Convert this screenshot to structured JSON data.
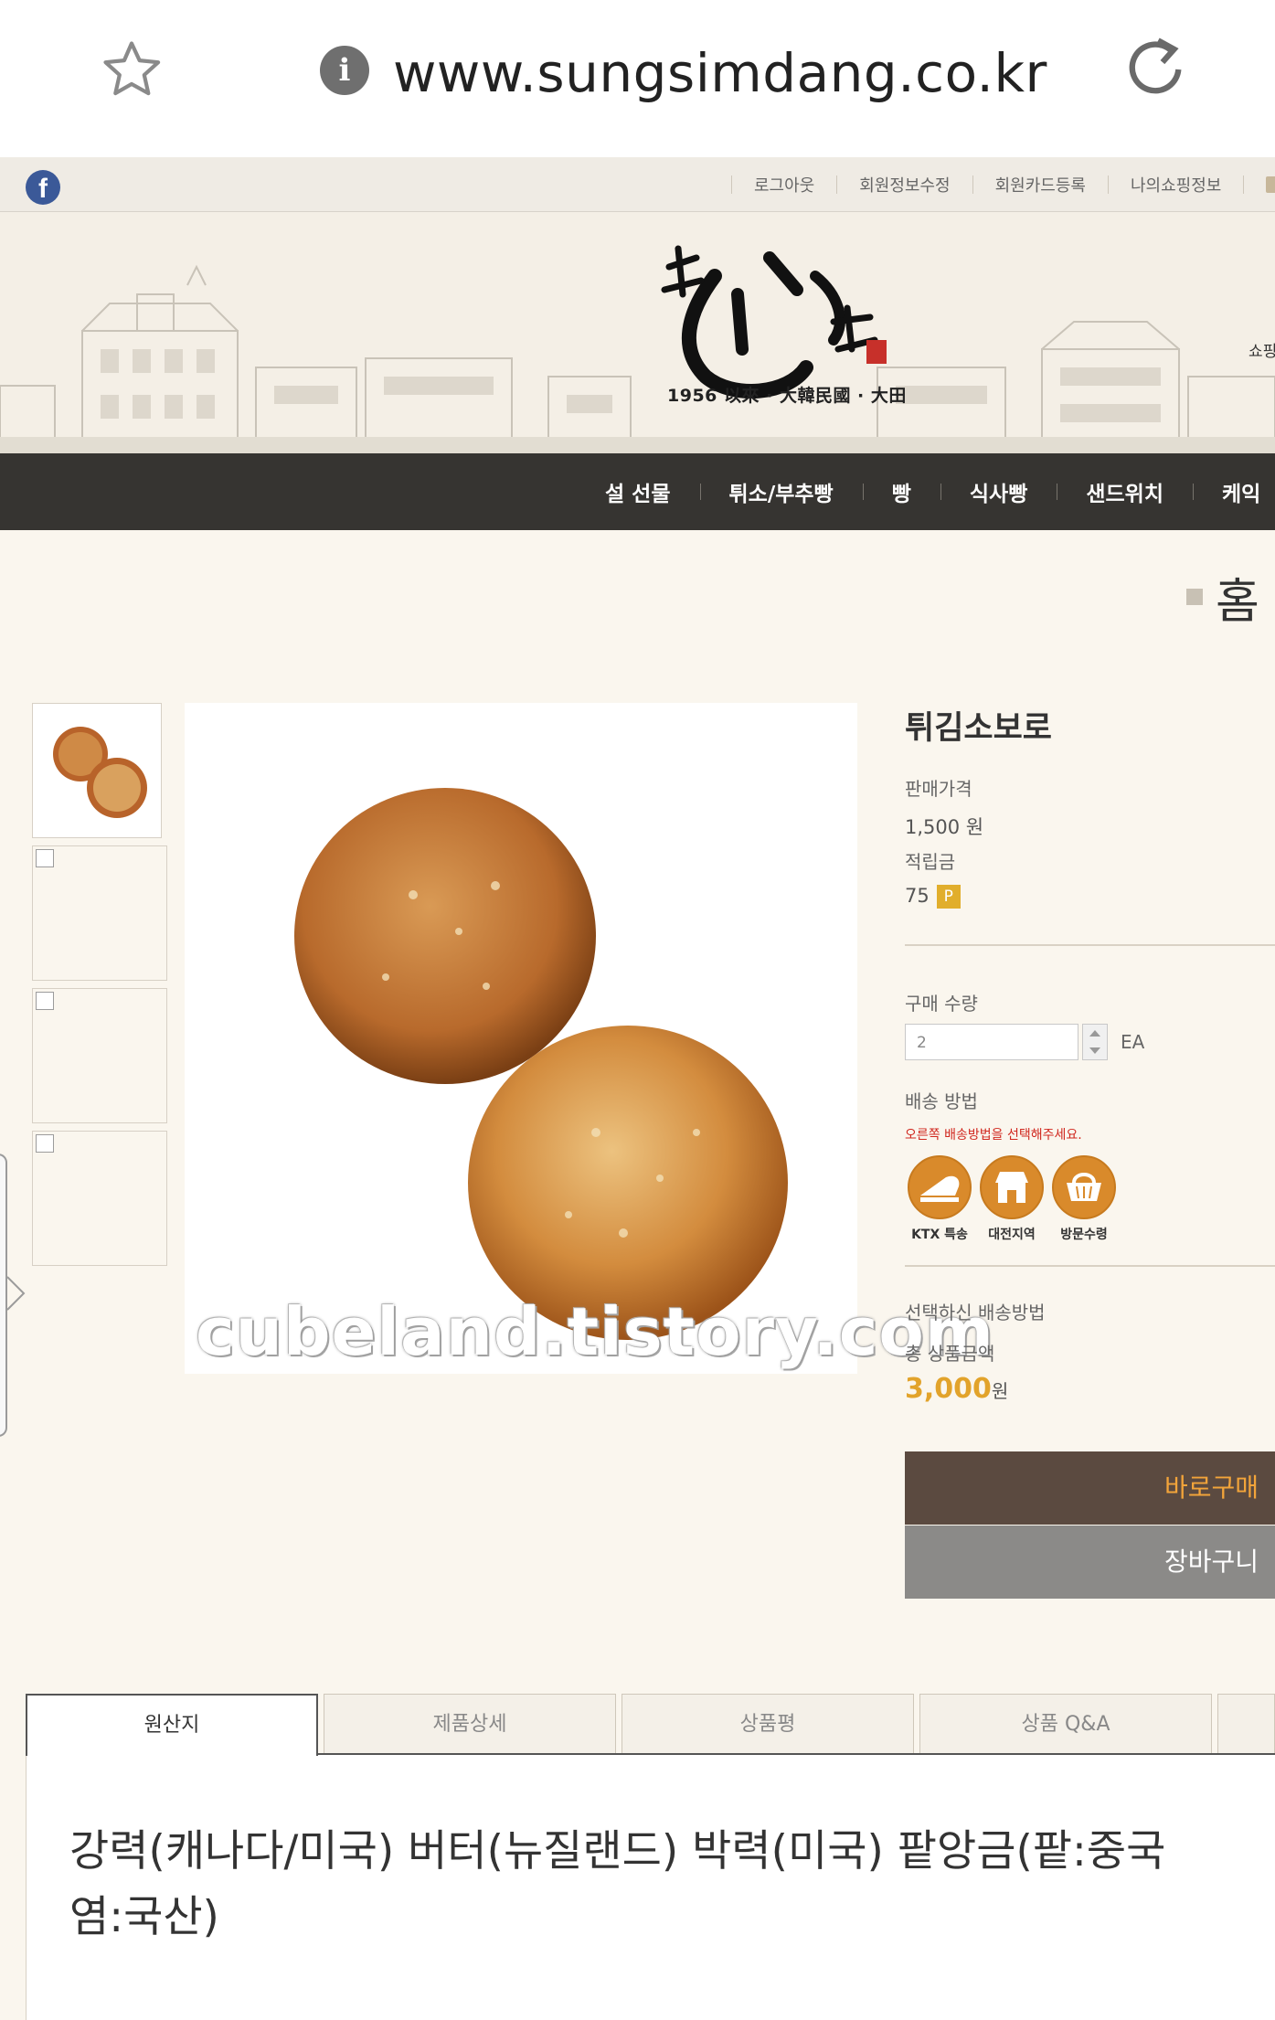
{
  "browser": {
    "url": "www.sungsimdang.co.kr"
  },
  "util_links": [
    "로그아웃",
    "회원정보수정",
    "회원카드등록",
    "나의쇼핑정보"
  ],
  "header": {
    "logo_tagline": "1956 以來 · 大韓民國 · 大田",
    "edge_text": "쇼핑"
  },
  "nav": [
    "설 선물",
    "튀소/부추빵",
    "빵",
    "식사빵",
    "샌드위치",
    "케익"
  ],
  "breadcrumb": {
    "home": "홈"
  },
  "watermark": "cubeland.tistory.com",
  "product": {
    "name": "튀김소보로",
    "price_label": "판매가격",
    "price": "1,500 원",
    "points_label": "적립금",
    "points": "75",
    "points_badge": "P",
    "qty_label": "구매 수량",
    "qty_value": "2",
    "qty_unit": "EA",
    "delivery_label": "배송 방법",
    "delivery_note": "오른쪽 배송방법을 선택해주세요.",
    "delivery_options": [
      "KTX 특송",
      "대전지역",
      "방문수령"
    ],
    "selected_delivery_label": "선택하신 배송방법",
    "total_label": "총 상품금액",
    "total_value": "3,000",
    "total_unit": "원",
    "buy_now": "바로구매",
    "add_to_cart": "장바구니"
  },
  "tabs": [
    "원산지",
    "제품상세",
    "상품평",
    "상품 Q&A"
  ],
  "origin_text": {
    "line1": "강력(캐나다/미국) 버터(뉴질랜드) 박력(미국) 팥앙금(팥:중국",
    "line2": "염:국산)"
  },
  "colors": {
    "nav_bg": "#363431",
    "buy_button": "#5b4a40",
    "buy_text": "#f2a43a",
    "cart_button": "#8b8a88",
    "total_price": "#e2a32b",
    "delivery_note": "#d0271e",
    "delivery_icon": "#d98a2b"
  }
}
